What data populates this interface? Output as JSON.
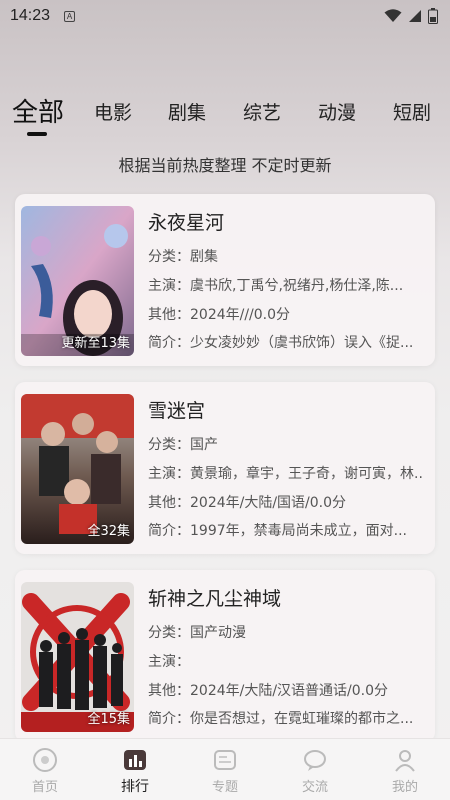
{
  "status_bar": {
    "time": "14:23",
    "notification_letter": "A"
  },
  "tabs": [
    {
      "label": "全部",
      "active": true
    },
    {
      "label": "电影",
      "active": false
    },
    {
      "label": "剧集",
      "active": false
    },
    {
      "label": "综艺",
      "active": false
    },
    {
      "label": "动漫",
      "active": false
    },
    {
      "label": "短剧",
      "active": false
    }
  ],
  "subtitle": "根据当前热度整理 不定时更新",
  "items": [
    {
      "title": "永夜星河",
      "category": "分类：剧集",
      "cast": "主演：虞书欣,丁禹兮,祝绪丹,杨仕泽,陈...",
      "other": "其他：2024年///0.0分",
      "intro": "简介：少女凌妙妙（虞书欣饰）误入《捉...",
      "badge": "更新至13集"
    },
    {
      "title": "雪迷宫",
      "category": "分类：国产",
      "cast": "主演：黄景瑜，章宇，王子奇，谢可寅，林...",
      "other": "其他：2024年/大陆/国语/0.0分",
      "intro": "简介：1997年，禁毒局尚未成立，面对...",
      "badge": "全32集"
    },
    {
      "title": "斩神之凡尘神域",
      "category": "分类：国产动漫",
      "cast": "主演：",
      "other": "其他：2024年/大陆/汉语普通话/0.0分",
      "intro": "简介：你是否想过，在霓虹璀璨的都市之...",
      "badge": "全15集"
    }
  ],
  "bottom_nav": [
    {
      "label": "首页",
      "icon": "home-icon",
      "active": false
    },
    {
      "label": "排行",
      "icon": "ranking-icon",
      "active": true
    },
    {
      "label": "专题",
      "icon": "topic-icon",
      "active": false
    },
    {
      "label": "交流",
      "icon": "chat-icon",
      "active": false
    },
    {
      "label": "我的",
      "icon": "profile-icon",
      "active": false
    }
  ]
}
